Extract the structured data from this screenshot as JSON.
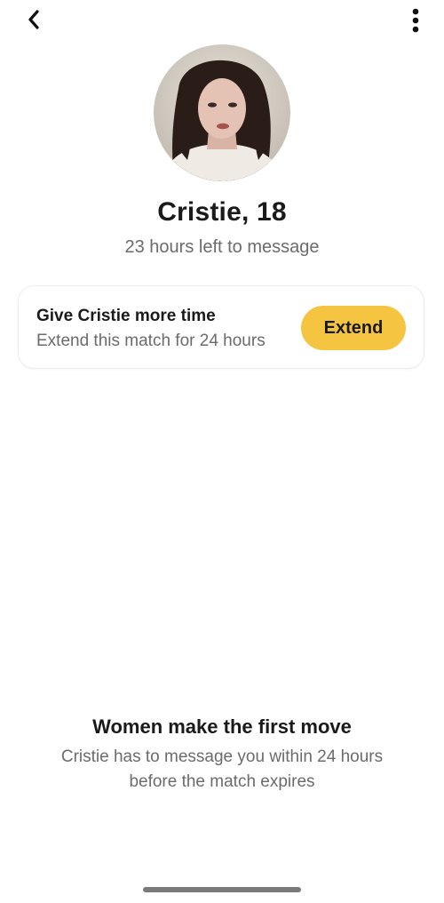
{
  "header": {
    "back_icon": "chevron-left-icon",
    "more_icon": "vertical-ellipsis-icon"
  },
  "profile": {
    "avatar_alt": "profile-photo",
    "name_age": "Cristie, 18",
    "time_left": "23 hours left to message"
  },
  "extend_card": {
    "title": "Give Cristie more time",
    "subtitle": "Extend this match for 24 hours",
    "button_label": "Extend",
    "button_color": "#f5c542"
  },
  "info": {
    "title": "Women make the first move",
    "body": "Cristie has to message you within 24 hours before the match expires"
  },
  "colors": {
    "accent": "#f5c542",
    "text_primary": "#1a1a1a",
    "text_secondary": "#6b6b6b",
    "background": "#ffffff"
  }
}
